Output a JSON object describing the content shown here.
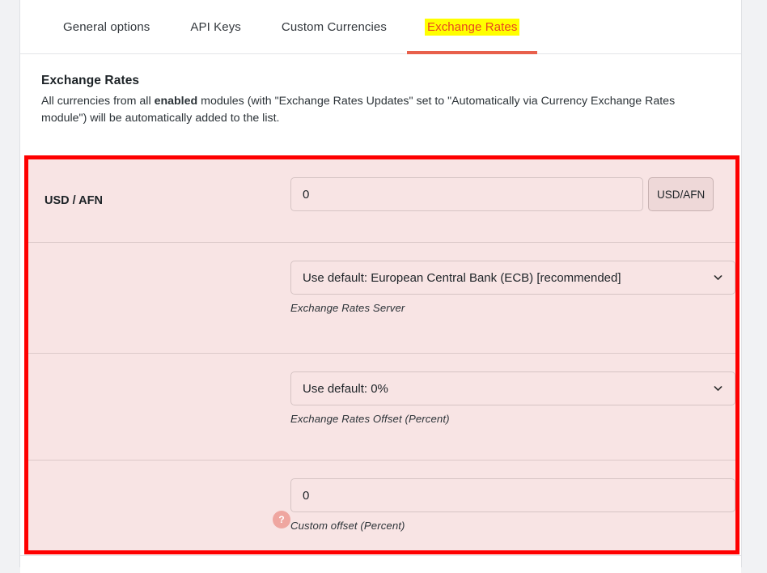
{
  "tabs": [
    {
      "label": "General options",
      "active": false
    },
    {
      "label": "API Keys",
      "active": false
    },
    {
      "label": "Custom Currencies",
      "active": false
    },
    {
      "label": "Exchange Rates",
      "active": true
    }
  ],
  "section": {
    "title": "Exchange Rates",
    "description_part1": "All currencies from all ",
    "description_bold": "enabled",
    "description_part2": " modules (with \"Exchange Rates Updates\" set to \"Automatically via Currency Exchange Rates module\") will be automatically added to the list."
  },
  "form": {
    "pair_label": "USD / AFN",
    "rate_value": "0",
    "rate_addon_label": "USD/AFN",
    "server_select_value": "Use default: European Central Bank (ECB) [recommended]",
    "server_help": "Exchange Rates Server",
    "offset_select_value": "Use default: 0%",
    "offset_help": "Exchange Rates Offset (Percent)",
    "custom_offset_value": "0",
    "custom_offset_help": "Custom offset (Percent)",
    "help_icon_label": "?"
  },
  "colors": {
    "highlight_border": "#fe0000",
    "highlight_fill": "#f8e4e4",
    "active_tab_bg": "#ffff00",
    "active_tab_text": "#e8461f",
    "tab_underline": "#e8604c",
    "help_bubble": "#efa6a0"
  }
}
